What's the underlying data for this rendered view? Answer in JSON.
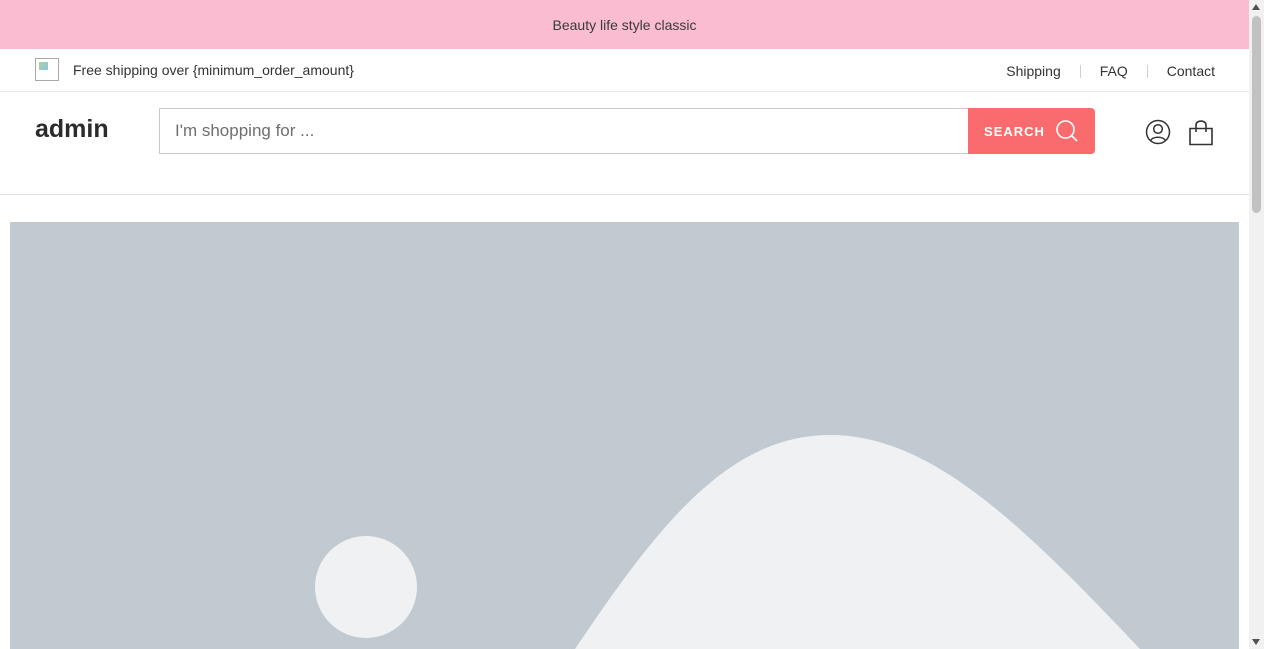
{
  "announcement": {
    "text": "Beauty life style classic"
  },
  "topbar": {
    "shipping_text": "Free shipping over {minimum_order_amount}",
    "links": [
      "Shipping",
      "FAQ",
      "Contact"
    ]
  },
  "header": {
    "logo": "admin",
    "search_placeholder": "I'm shopping for ...",
    "search_button": "SEARCH",
    "icons": [
      "account-icon",
      "shopping-bag-icon"
    ]
  },
  "hero": {
    "image": "placeholder-image"
  },
  "colors": {
    "announcement_bg": "#f9bcd1",
    "search_button_bg": "#f96b6c",
    "hero_bg": "#c1c9d1",
    "hero_shape": "#eff1f3"
  }
}
